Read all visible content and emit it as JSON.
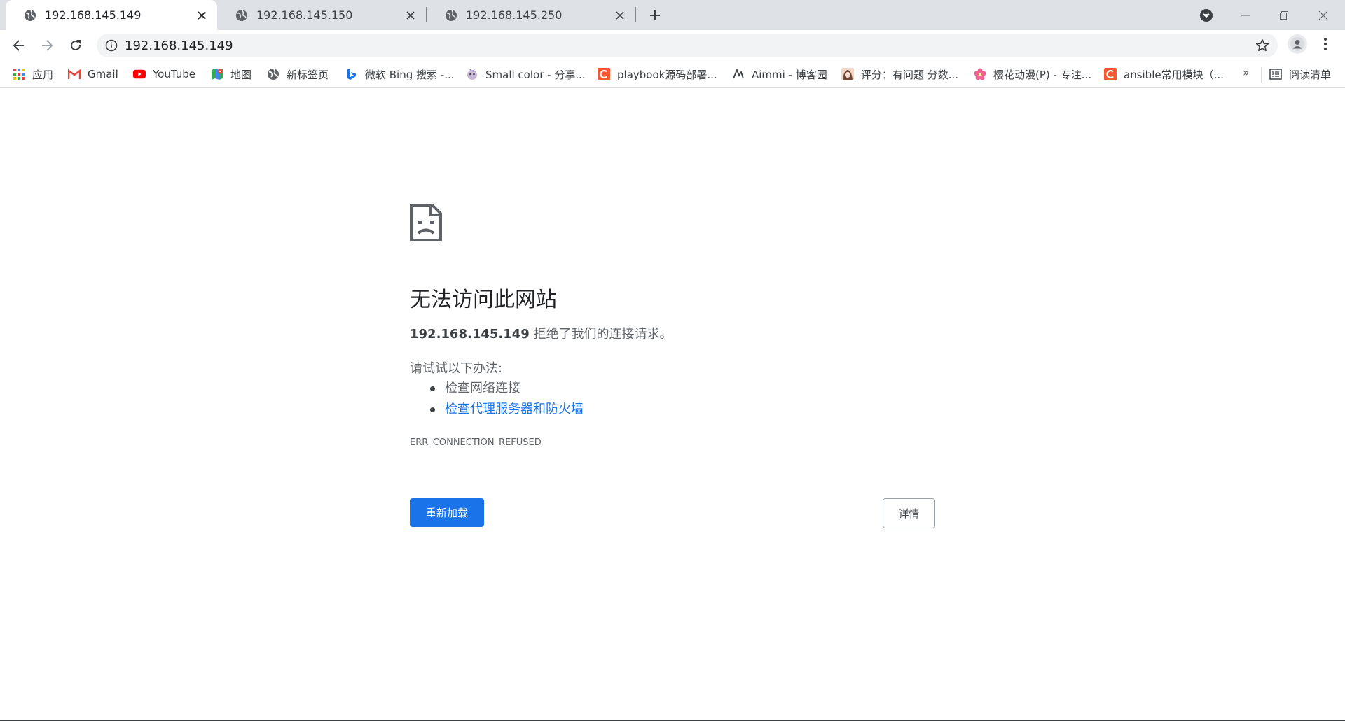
{
  "tabs": [
    {
      "title": "192.168.145.149",
      "active": true
    },
    {
      "title": "192.168.145.150",
      "active": false
    },
    {
      "title": "192.168.145.250",
      "active": false
    }
  ],
  "toolbar": {
    "url": "192.168.145.149"
  },
  "bookmarks": [
    {
      "label": "应用",
      "icon": "apps-grid-icon"
    },
    {
      "label": "Gmail",
      "icon": "gmail-icon"
    },
    {
      "label": "YouTube",
      "icon": "youtube-icon"
    },
    {
      "label": "地图",
      "icon": "maps-icon"
    },
    {
      "label": "新标签页",
      "icon": "globe-icon"
    },
    {
      "label": "微软 Bing 搜索 -...",
      "icon": "bing-icon"
    },
    {
      "label": "Small color - 分享...",
      "icon": "smallcolor-icon"
    },
    {
      "label": "playbook源码部署...",
      "icon": "csdn-icon"
    },
    {
      "label": "Aimmi - 博客园",
      "icon": "aimmi-icon"
    },
    {
      "label": "评分：有问题 分数...",
      "icon": "avatar-bookmark-icon"
    },
    {
      "label": "樱花动漫(P) - 专注...",
      "icon": "sakura-icon"
    },
    {
      "label": "ansible常用模块（...",
      "icon": "csdn-icon"
    }
  ],
  "bookmarks_more": "»",
  "reading_list": "阅读清单",
  "error": {
    "title": "无法访问此网站",
    "host": "192.168.145.149",
    "desc_suffix": " 拒绝了我们的连接请求。",
    "try_label": "请试试以下办法:",
    "suggestions": [
      "检查网络连接",
      "检查代理服务器和防火墙"
    ],
    "code": "ERR_CONNECTION_REFUSED",
    "reload_label": "重新加载",
    "details_label": "详情"
  },
  "colors": {
    "accent": "#1a73e8",
    "tabstrip": "#dee1e6",
    "omnibox": "#f1f3f4"
  }
}
